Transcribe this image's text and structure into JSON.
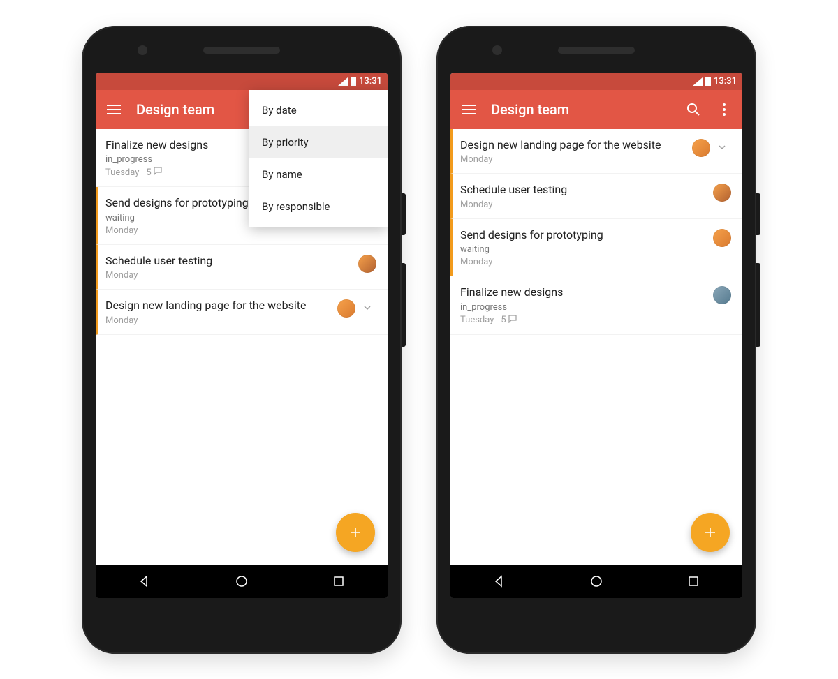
{
  "status": {
    "time": "13:31"
  },
  "appbar": {
    "title": "Design team"
  },
  "sortMenu": {
    "items": [
      {
        "label": "By date"
      },
      {
        "label": "By priority"
      },
      {
        "label": "By name"
      },
      {
        "label": "By responsible"
      }
    ],
    "selected": "By priority"
  },
  "left": {
    "tasks": [
      {
        "title": "Finalize new designs",
        "status": "in_progress",
        "date": "Tuesday",
        "comments": "5",
        "accent": false,
        "avatar": null,
        "chevron": false
      },
      {
        "title": "Send designs for prototyping",
        "status": "waiting",
        "date": "Monday",
        "comments": null,
        "accent": true,
        "avatar": null,
        "chevron": false
      },
      {
        "title": "Schedule user testing",
        "status": null,
        "date": "Monday",
        "comments": null,
        "accent": true,
        "avatar": "purple",
        "chevron": false
      },
      {
        "title": "Design new landing page for the website",
        "status": null,
        "date": "Monday",
        "comments": null,
        "accent": true,
        "avatar": "orange",
        "chevron": true
      }
    ]
  },
  "right": {
    "tasks": [
      {
        "title": "Design new landing page for the website",
        "status": null,
        "date": "Monday",
        "comments": null,
        "accent": true,
        "avatar": "orange",
        "chevron": true
      },
      {
        "title": "Schedule user testing",
        "status": null,
        "date": "Monday",
        "comments": null,
        "accent": true,
        "avatar": "purple",
        "chevron": false
      },
      {
        "title": "Send designs for prototyping",
        "status": "waiting",
        "date": "Monday",
        "comments": null,
        "accent": true,
        "avatar": "orange",
        "chevron": false
      },
      {
        "title": "Finalize new designs",
        "status": "in_progress",
        "date": "Tuesday",
        "comments": "5",
        "accent": false,
        "avatar": "blue",
        "chevron": false
      }
    ]
  }
}
